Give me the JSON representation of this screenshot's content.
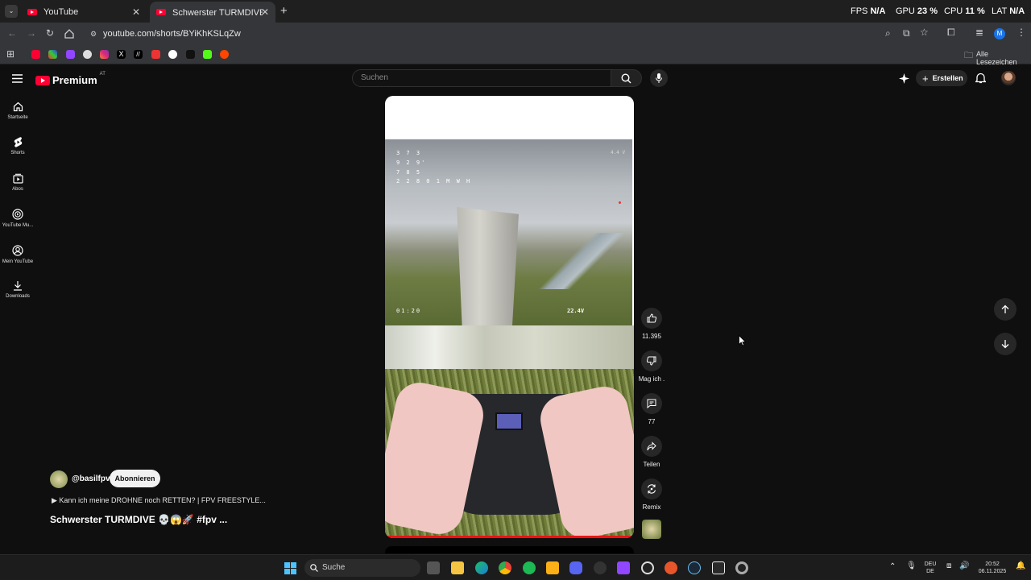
{
  "browser": {
    "tabs": [
      {
        "title": "YouTube",
        "close": "✕"
      },
      {
        "title": "Schwerster TURMDIVE 💀😱🚀",
        "close": "✕"
      }
    ],
    "new_tab": "+",
    "url": "youtube.com/shorts/BYiKhKSLqZw",
    "bookmarks_folder": "Alle Lesezeichen",
    "perf": {
      "fps_label": "FPS",
      "fps_value": "N/A",
      "gpu_label": "GPU",
      "gpu_value": "23 %",
      "cpu_label": "CPU",
      "cpu_value": "11 %",
      "lat_label": "LAT",
      "lat_value": "N/A"
    },
    "profile_initial": "M"
  },
  "youtube": {
    "logo_text": "Premium",
    "logo_region": "AT",
    "search_placeholder": "Suchen",
    "create_label": "Erstellen",
    "sidebar": [
      {
        "label": "Startseite",
        "icon": "home-icon"
      },
      {
        "label": "Shorts",
        "icon": "shorts-icon"
      },
      {
        "label": "Abos",
        "icon": "subscriptions-icon"
      },
      {
        "label": "YouTube Mu...",
        "icon": "music-icon"
      },
      {
        "label": "Mein YouTube",
        "icon": "profile-icon"
      },
      {
        "label": "Downloads",
        "icon": "download-icon"
      }
    ],
    "short": {
      "channel": "@basilfpv",
      "subscribe_label": "Abonnieren",
      "related_video": "▶  Kann ich meine DROHNE noch RETTEN? | FPV FREESTYLE...",
      "title": "Schwerster TURMDIVE 💀😱🚀 #fpv ...",
      "osd": {
        "line1": "3  7 3",
        "line2": "9 2 9'",
        "line3": "7  8 5",
        "line4": "2 2 8 0 1 M W H",
        "timer": "01:20",
        "voltage": "22.4V",
        "right_top": "4.4 V"
      },
      "actions": {
        "likes": "11.395",
        "dislike_label": "Mag ich .",
        "comments": "77",
        "share_label": "Teilen",
        "remix_label": "Remix"
      }
    }
  },
  "taskbar": {
    "search_label": "Suche",
    "lang_top": "DEU",
    "lang_bottom": "DE",
    "time": "20:52",
    "date": "06.11.2025"
  },
  "colors": {
    "youtube_red": "#ff0033",
    "background": "#0f0f0f",
    "chrome": "#35363a"
  }
}
